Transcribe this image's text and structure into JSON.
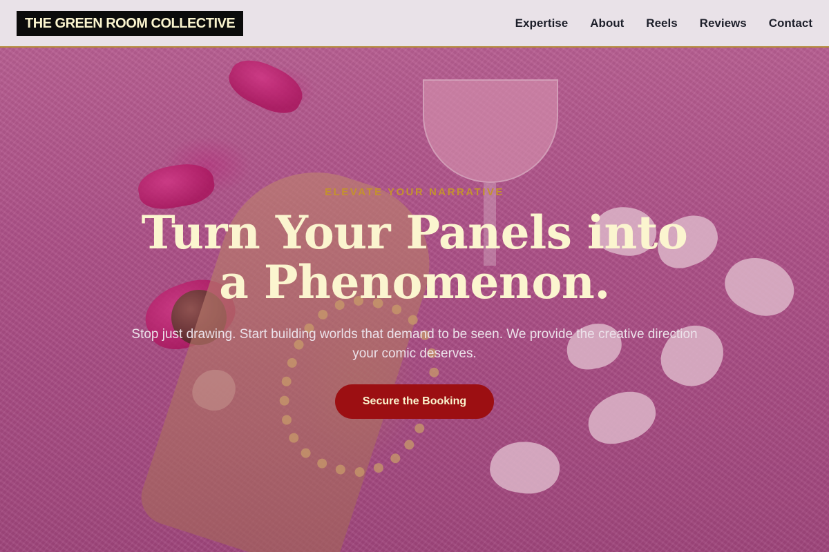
{
  "header": {
    "logo": "THE GREEN ROOM COLLECTIVE",
    "nav": [
      {
        "label": "Expertise"
      },
      {
        "label": "About"
      },
      {
        "label": "Reels"
      },
      {
        "label": "Reviews"
      },
      {
        "label": "Contact"
      }
    ]
  },
  "hero": {
    "eyebrow": "ELEVATE YOUR NARRATIVE",
    "headline": "Turn Your Panels into a Phenomenon.",
    "subhead": "Stop just drawing. Start building worlds that demand to be seen. We provide the creative direction your comic deserves.",
    "cta_label": "Secure the Booking"
  },
  "colors": {
    "header_bg": "#e9e2e8",
    "header_border": "#b38a3a",
    "logo_bg": "#0b0b0b",
    "logo_text": "#fbf5cf",
    "accent_gold": "#c4922d",
    "headline": "#fbf5cf",
    "cta_bg": "#9c0f12",
    "hero_bg": "#b85a92"
  }
}
